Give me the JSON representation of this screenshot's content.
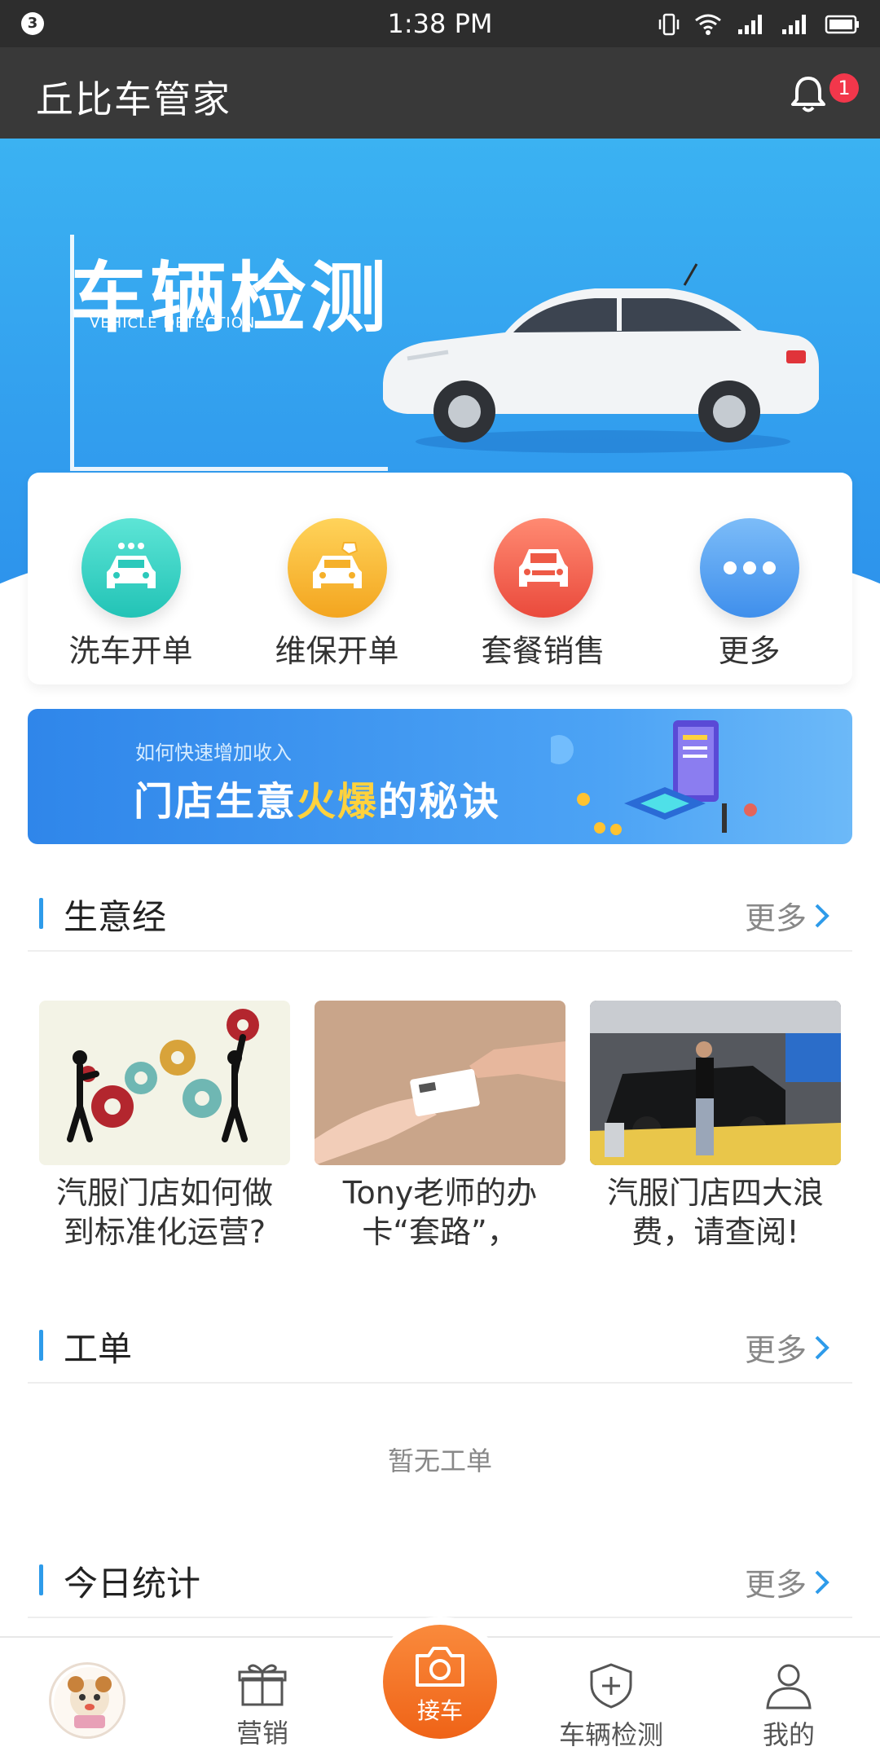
{
  "status_bar": {
    "notification_count": "3",
    "time": "1:38 PM",
    "icons": [
      "vibrate-icon",
      "wifi-icon",
      "signal-icon",
      "signal-icon-2",
      "battery-icon"
    ]
  },
  "app_bar": {
    "title": "丘比车管家",
    "notification_badge": "1"
  },
  "banner": {
    "title": "车辆检测",
    "subtitle": "VEHICLE DETECTION"
  },
  "quick_actions": [
    {
      "label": "洗车开单",
      "icon": "car-wash-icon",
      "color": "#2fd3c5"
    },
    {
      "label": "维保开单",
      "icon": "car-repair-icon",
      "color": "#f5b730"
    },
    {
      "label": "套餐销售",
      "icon": "car-package-icon",
      "color": "#f0564a"
    },
    {
      "label": "更多",
      "icon": "more-icon",
      "color": "#4a9cf0"
    }
  ],
  "promo": {
    "subtitle": "如何快速增加收入",
    "title_a": "门店生意",
    "title_hot": "火爆",
    "title_b": "的秘诀"
  },
  "sections": {
    "business": {
      "title": "生意经",
      "more": "更多"
    },
    "orders": {
      "title": "工单",
      "more": "更多",
      "empty": "暂无工单"
    },
    "stats": {
      "title": "今日统计",
      "more": "更多"
    }
  },
  "articles": [
    {
      "title": "汽服门店如何做到标准化运营?"
    },
    {
      "title": "Tony老师的办卡“套路”，"
    },
    {
      "title": "汽服门店四大浪费，请查阅!"
    }
  ],
  "bottom_nav": {
    "marketing": "营销",
    "center": "接车",
    "inspection": "车辆检测",
    "mine": "我的"
  },
  "colors": {
    "accent": "#2e9bea",
    "center_button": "#ef6317",
    "badge": "#f2374b"
  }
}
